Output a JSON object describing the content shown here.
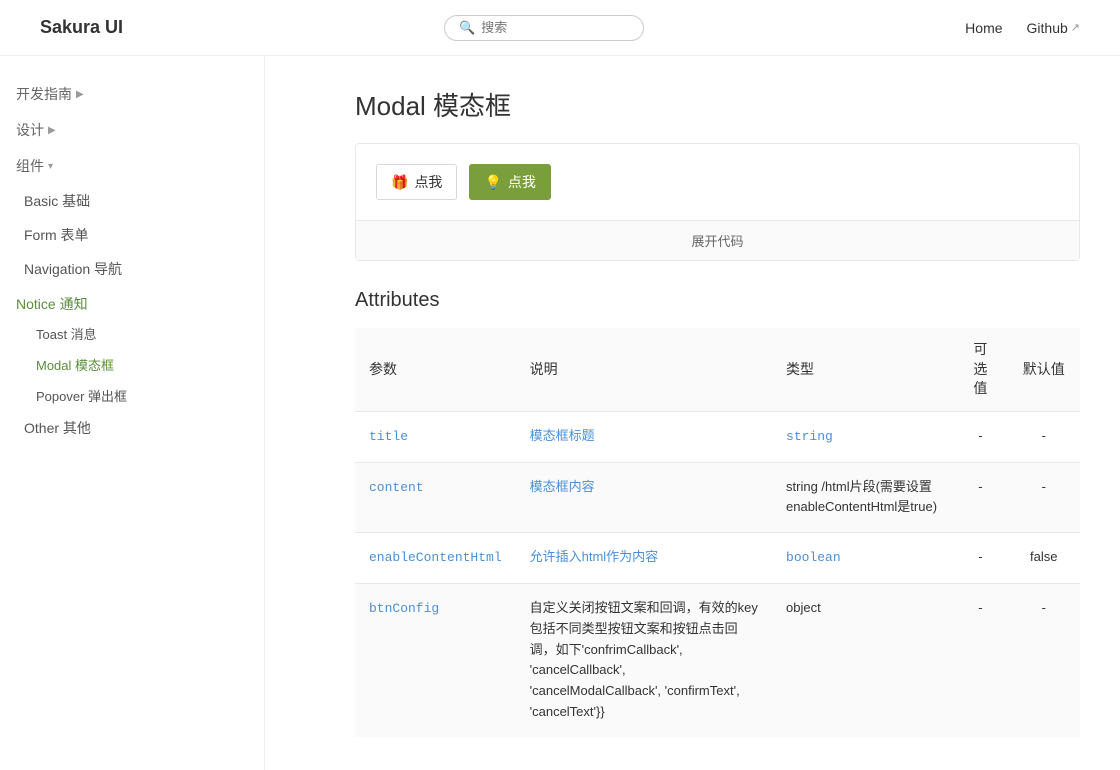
{
  "header": {
    "logo": "Sakura UI",
    "search_placeholder": "搜索",
    "nav_home": "Home",
    "nav_github": "Github"
  },
  "sidebar": {
    "guide_label": "开发指南",
    "design_label": "设计",
    "components_label": "组件",
    "items": [
      {
        "id": "basic",
        "label": "Basic 基础"
      },
      {
        "id": "form",
        "label": "Form 表单"
      },
      {
        "id": "navigation",
        "label": "Navigation 导航"
      },
      {
        "id": "notice",
        "label": "Notice 通知",
        "active": true
      },
      {
        "id": "toast",
        "label": "Toast 消息",
        "sub": true
      },
      {
        "id": "modal",
        "label": "Modal 模态框",
        "sub": true,
        "active": true
      },
      {
        "id": "popover",
        "label": "Popover 弹出框",
        "sub": true
      },
      {
        "id": "other",
        "label": "Other 其他"
      }
    ]
  },
  "content": {
    "page_title": "Modal 模态框",
    "btn1_label": "点我",
    "btn2_label": "点我",
    "expand_code_label": "展开代码",
    "attributes_title": "Attributes",
    "table_headers": {
      "param": "参数",
      "desc": "说明",
      "type": "类型",
      "optional": "可选值",
      "default": "默认值"
    },
    "rows": [
      {
        "param": "title",
        "desc": "模态框标题",
        "type": "string",
        "optional": "-",
        "default": "-"
      },
      {
        "param": "content",
        "desc": "模态框内容",
        "type": "string /html片段(需要设置enableContentHtml是true)",
        "optional": "-",
        "default": "-"
      },
      {
        "param": "enableContentHtml",
        "desc": "允许插入html作为内容",
        "type": "boolean",
        "optional": "-",
        "default": "false"
      },
      {
        "param": "btnConfig",
        "desc": "自定义关闭按钮文案和回调，有效的key包括不同类型按钮文案和按钮点击回调，如下'confrimCallback', 'cancelCallback', 'cancelModalCallback', 'confirmText', 'cancelText'}}",
        "type": "object",
        "optional": "-",
        "default": "-"
      }
    ]
  }
}
